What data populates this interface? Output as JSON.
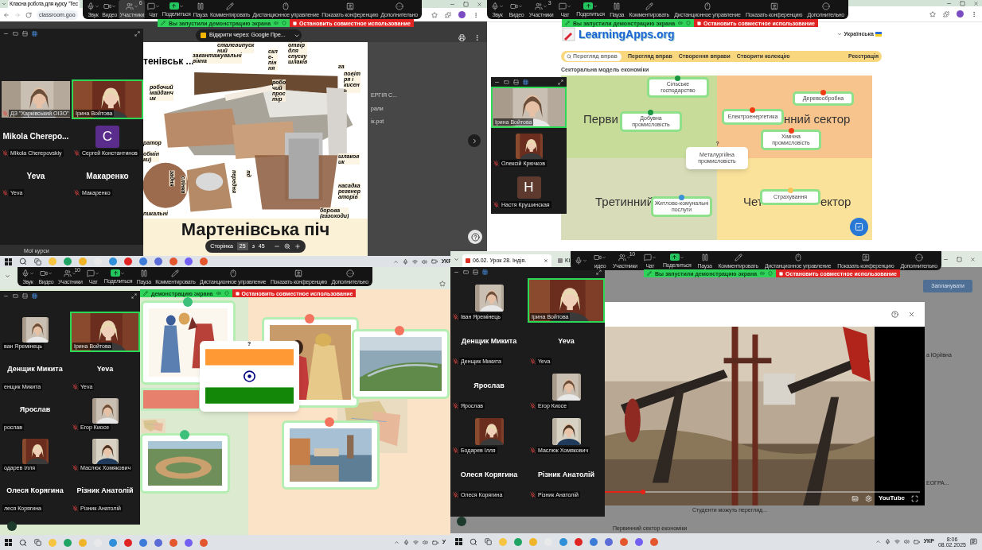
{
  "screens": [
    {
      "kind": "slides",
      "browser": {
        "tab": "Класна робота для курсу \"Тес",
        "address": "classroom.goo"
      },
      "toolbar": {
        "items": [
          {
            "label": "Звук",
            "menu": true,
            "selected": false
          },
          {
            "label": "Видео",
            "menu": true,
            "selected": false
          },
          {
            "label": "Участники",
            "count": "6",
            "menu": true,
            "selected": true
          },
          {
            "label": "Чат",
            "menu": true,
            "selected": false
          },
          {
            "label": "Поделиться",
            "menu": true,
            "selected": false
          },
          {
            "label": "Пауза",
            "menu": false,
            "selected": false
          },
          {
            "label": "Комментировать",
            "menu": false,
            "selected": false
          },
          {
            "label": "Дистанционное управление",
            "menu": false,
            "selected": false
          },
          {
            "label": "Показать конференцию",
            "menu": false,
            "selected": false
          },
          {
            "label": "Дополнительно",
            "menu": false,
            "selected": false
          }
        ]
      },
      "banner": {
        "status": "Вы запустили демонстрацию экрана",
        "stop": "Остановить совместное использование"
      },
      "participants": [
        {
          "kind": "video",
          "label": "ДЗ \"Харківський ОІЗО\"",
          "muted": true,
          "selected": false
        },
        {
          "kind": "video",
          "label": "Ірина Войтова",
          "muted": false,
          "selected": true
        },
        {
          "kind": "name",
          "name": "Mikola  Cherepo...",
          "label": "Mikola Cherepovskiy",
          "muted": true,
          "selected": false
        },
        {
          "kind": "avatar",
          "letter": "C",
          "color": "#5a2d8c",
          "label": "Сергей Константинов",
          "muted": true,
          "selected": false
        },
        {
          "kind": "name",
          "name": "Yeva",
          "label": "Yeva",
          "muted": true,
          "selected": false
        },
        {
          "kind": "name",
          "name": "Макаренко",
          "label": "Макаренко",
          "muted": true,
          "selected": false
        }
      ],
      "viewer": {
        "open_with": "Відкрити через: Google Пре...",
        "slide": {
          "heading": "тенівськ ...",
          "labels": [
            "сталевипуск ний",
            "завантажувальні вікна",
            "скл е- пін ня",
            "отвір для спуску шлаків",
            "робочий майданч ик",
            "робо чий прос тір",
            "га",
            "повіт ря і кисен ь",
            "ратор",
            "обмін ки)",
            "шлаков ик",
            "насадка регенер аторів",
            "задня",
            "слінка",
            "передня",
            "пд",
            "пикальні",
            "борова (газоходи)"
          ],
          "title": "Мартенівська піч"
        },
        "pager": {
          "label": "Сторінка",
          "page": "25",
          "separator": "з",
          "total": "45"
        },
        "files": [
          "ЕРГІЯ С...",
          "рали",
          "ік.pot"
        ],
        "sidebar_item": "Мої курси"
      },
      "taskbar": {
        "language": "УКР"
      }
    },
    {
      "kind": "learningapps",
      "toolbar": {
        "items": [
          {
            "label": "Звук",
            "menu": true,
            "selected": false
          },
          {
            "label": "Видео",
            "menu": true,
            "selected": false
          },
          {
            "label": "Участники",
            "count": "3",
            "menu": true,
            "selected": false
          },
          {
            "label": "Чат",
            "menu": true,
            "selected": false
          },
          {
            "label": "Поделиться",
            "menu": true,
            "selected": false
          },
          {
            "label": "Пауза",
            "menu": false,
            "selected": false
          },
          {
            "label": "Комментировать",
            "menu": false,
            "selected": false
          },
          {
            "label": "Дистанционное управление",
            "menu": false,
            "selected": false
          },
          {
            "label": "Показать конференцию",
            "menu": false,
            "selected": false
          },
          {
            "label": "Дополнительно",
            "menu": false,
            "selected": false
          }
        ]
      },
      "banner": {
        "status": "Вы запустили демонстрацию экрана",
        "stop": "Остановить совместное использование"
      },
      "participants": [
        {
          "kind": "video",
          "label": "Ірина Войтова",
          "muted": false,
          "selected": true
        },
        {
          "label": "Олексій Крючков",
          "muted": true,
          "selected": false
        },
        {
          "kind": "avatar",
          "letter": "H",
          "color": "#5e3a2e",
          "label": "Настя Крушинская",
          "muted": true,
          "selected": false
        }
      ],
      "site": {
        "logo": "LearningApps.org",
        "language": "Українська",
        "search_placeholder": "Перегляд вправ",
        "nav": [
          "Перегляд вправ",
          "Створення вправи",
          "Створити колекцію"
        ],
        "account": "Реєстрація",
        "title": "Секторальна модель економіки",
        "board": {
          "labels": [
            "Перви",
            "нний сектор",
            "Третинний",
            "Чет",
            "ектор"
          ],
          "cards": [
            {
              "kind": "pinned",
              "text": "Сільське господарство",
              "color": "#1a9641"
            },
            {
              "kind": "pinned",
              "text": "Добувна промисловість",
              "color": "#1a9641"
            },
            {
              "kind": "pinned",
              "text": "Електроенергетика",
              "color": "#f03c14"
            },
            {
              "kind": "pinned",
              "text": "Деревообробна",
              "color": "#f03c14"
            },
            {
              "kind": "pinned",
              "text": "Хімічна промисловість",
              "color": "#f03c14"
            },
            {
              "kind": "question",
              "text": "Металургійна промисловість",
              "marker": "?"
            },
            {
              "kind": "pinned",
              "text": "Житлово-комунальні послуги",
              "color": "#3b8fd6"
            },
            {
              "kind": "pinned",
              "text": "Страхування",
              "color": "#f6c25b"
            }
          ]
        }
      }
    },
    {
      "kind": "board",
      "toolbar": {
        "items": [
          {
            "label": "Звук",
            "menu": true,
            "selected": false
          },
          {
            "label": "Видео",
            "menu": true,
            "selected": false
          },
          {
            "label": "Участники",
            "count": "10",
            "menu": true,
            "selected": false
          },
          {
            "label": "Чат",
            "menu": true,
            "selected": false
          },
          {
            "label": "Поделиться",
            "menu": true,
            "selected": false
          },
          {
            "label": "Пауза",
            "menu": false,
            "selected": false
          },
          {
            "label": "Комментировать",
            "menu": false,
            "selected": false
          },
          {
            "label": "Дистанционное управление",
            "menu": false,
            "selected": false
          },
          {
            "label": "Показать конференцию",
            "menu": false,
            "selected": false
          },
          {
            "label": "Дополнительно",
            "menu": false,
            "selected": false
          }
        ]
      },
      "banner": {
        "status": "демонстрацию экрана",
        "stop": "Остановить совместное использование"
      },
      "participants": [
        {
          "label": "ван Яремінець",
          "muted": false,
          "selected": false
        },
        {
          "kind": "video",
          "label": "Ірина Войтова",
          "muted": false,
          "selected": true
        },
        {
          "kind": "name",
          "name": "Денщик Микита",
          "label": "енщик Микита",
          "muted": false,
          "selected": false
        },
        {
          "kind": "name",
          "name": "Yeva",
          "label": "Yeva",
          "muted": true,
          "selected": false
        },
        {
          "kind": "name",
          "name": "Ярослав",
          "label": "рослав",
          "muted": false,
          "selected": false
        },
        {
          "label": "Егор Киосе",
          "muted": true,
          "selected": false
        },
        {
          "label": "одарев Ілля",
          "muted": false,
          "selected": false
        },
        {
          "label": "Маслюк Хомякович",
          "muted": true,
          "selected": false
        },
        {
          "kind": "name",
          "name": "Олеся Корягина",
          "label": "леся Корягина",
          "muted": false,
          "selected": false
        },
        {
          "kind": "name",
          "name": "Різник Анатолій",
          "label": "Різник Анатолій",
          "muted": true,
          "selected": false
        }
      ],
      "cards": [
        {
          "kind": "picture",
          "color": "#3cc07a"
        },
        {
          "kind": "flag",
          "marker": "?"
        },
        {
          "kind": "picture",
          "color": "#f4735e"
        },
        {
          "kind": "picture",
          "color": "#f4735e"
        },
        {
          "kind": "picture",
          "color": "#3cc07a"
        },
        {
          "kind": "picture",
          "color": "#f4735e"
        }
      ],
      "taskbar": {
        "language": "У"
      }
    },
    {
      "kind": "video",
      "browser": {
        "tabs": [
          "06.02. Урок 28. Індія.",
          "Ki"
        ]
      },
      "toolbar": {
        "items": [
          {
            "menu": true,
            "selected": false
          },
          {
            "label": "идео",
            "menu": true,
            "selected": false
          },
          {
            "label": "Участники",
            "count": "10",
            "menu": true,
            "selected": false
          },
          {
            "label": "Чат",
            "menu": true,
            "selected": false
          },
          {
            "label": "Поделиться",
            "menu": true,
            "selected": false
          },
          {
            "label": "Пауза",
            "menu": false,
            "selected": false
          },
          {
            "label": "Комментировать",
            "menu": false,
            "selected": false
          },
          {
            "label": "Дистанционное управление",
            "menu": false,
            "selected": false
          },
          {
            "label": "Показать конференцию",
            "menu": false,
            "selected": false
          },
          {
            "label": "Дополнительно",
            "menu": false,
            "selected": false
          }
        ]
      },
      "banner": {
        "status": "Вы запустили демонстрацию экрана",
        "stop": "Остановить совместное использование"
      },
      "participants": [
        {
          "label": "Іван Яремінець",
          "muted": true,
          "selected": false
        },
        {
          "kind": "video",
          "label": "Ірина Войтова",
          "muted": false,
          "selected": true
        },
        {
          "kind": "name",
          "name": "Денщик Микита",
          "label": "Денщик Микита",
          "muted": true,
          "selected": false
        },
        {
          "kind": "name",
          "name": "Yeva",
          "label": "Yeva",
          "muted": true,
          "selected": false
        },
        {
          "kind": "name",
          "name": "Ярослав",
          "label": "Ярослав",
          "muted": true,
          "selected": false
        },
        {
          "label": "Егор Киосе",
          "muted": true,
          "selected": false
        },
        {
          "label": "Бодарев Ілля",
          "muted": true,
          "selected": false
        },
        {
          "label": "Маслюк Хомякович",
          "muted": true,
          "selected": false
        },
        {
          "kind": "name",
          "name": "Олеся Корягина",
          "label": "Олеся Корягина",
          "muted": true,
          "selected": false
        },
        {
          "kind": "name",
          "name": "Різник Анатолій",
          "label": "Різник Анатолій",
          "muted": true,
          "selected": false
        }
      ],
      "page": {
        "schedule_button": "Запланувати",
        "fields": [
          "а Юріївна",
          "ЕОГРА..."
        ],
        "note": "Студенти можуть перегляд...",
        "post": "Первинний сектор економіки"
      },
      "player": {
        "brand": "YouTube",
        "level": 0.12
      },
      "taskbar": {
        "language": "УКР",
        "time": "8:06",
        "date": "08.02.2025"
      }
    }
  ]
}
